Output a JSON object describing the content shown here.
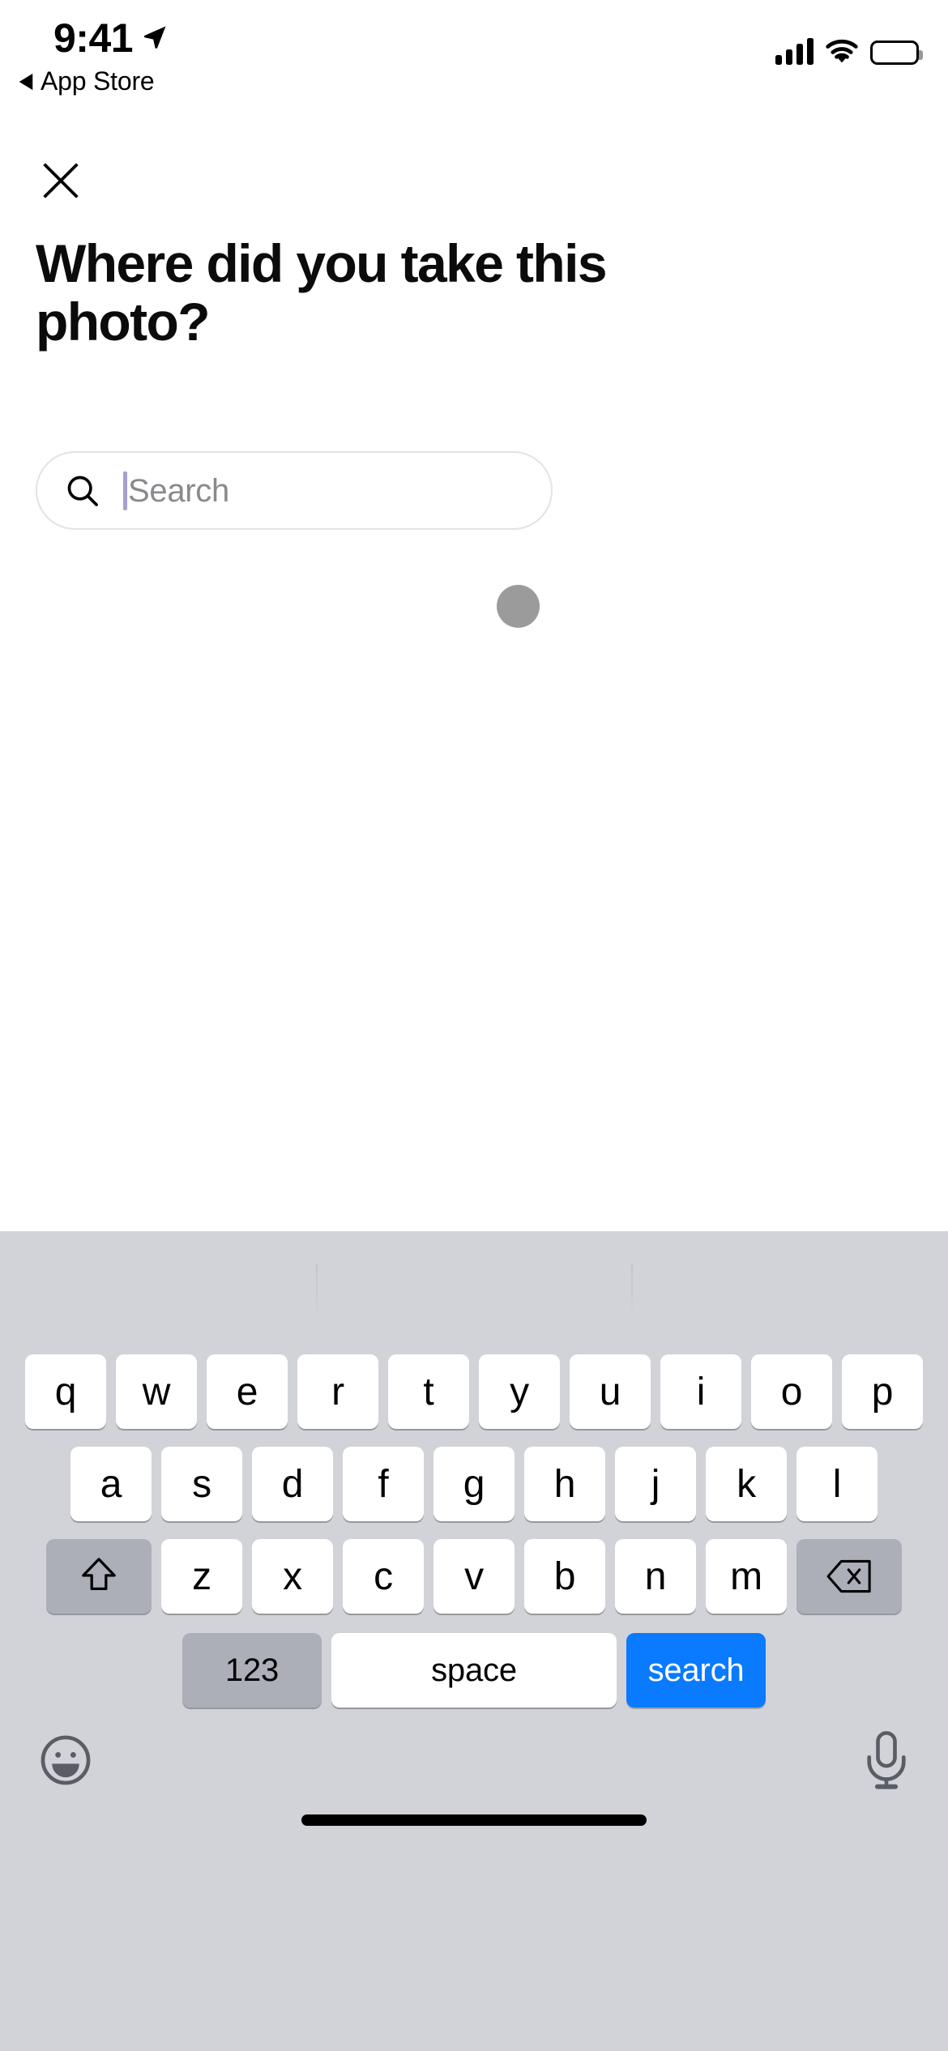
{
  "status_bar": {
    "time": "9:41",
    "location_icon": "location-arrow-icon",
    "back_to_app_label": "App Store",
    "back_triangle_icon": "back-triangle-icon",
    "cellular_icon": "cellular-signal-icon",
    "cellular_bars": 4,
    "wifi_icon": "wifi-icon",
    "battery_icon": "battery-full-icon"
  },
  "nav": {
    "close_icon": "close-icon"
  },
  "screen": {
    "headline": "Where did you take this photo?"
  },
  "search": {
    "icon": "search-icon",
    "placeholder": "Search",
    "value": "",
    "caret_color": "#a89fd2"
  },
  "loading": {
    "indicator_name": "loading-dot",
    "color": "#9b9b9b"
  },
  "keyboard": {
    "background_color": "#d1d3d9",
    "rows": [
      [
        "q",
        "w",
        "e",
        "r",
        "t",
        "y",
        "u",
        "i",
        "o",
        "p"
      ],
      [
        "a",
        "s",
        "d",
        "f",
        "g",
        "h",
        "j",
        "k",
        "l"
      ],
      [
        "z",
        "x",
        "c",
        "v",
        "b",
        "n",
        "m"
      ]
    ],
    "shift_icon": "shift-arrow-icon",
    "delete_icon": "delete-backspace-icon",
    "numbers_label": "123",
    "space_label": "space",
    "return_label": "search",
    "return_color": "#0a7aff",
    "emoji_icon": "emoji-smiley-icon",
    "dictation_icon": "microphone-icon"
  },
  "home_indicator": "home-indicator"
}
